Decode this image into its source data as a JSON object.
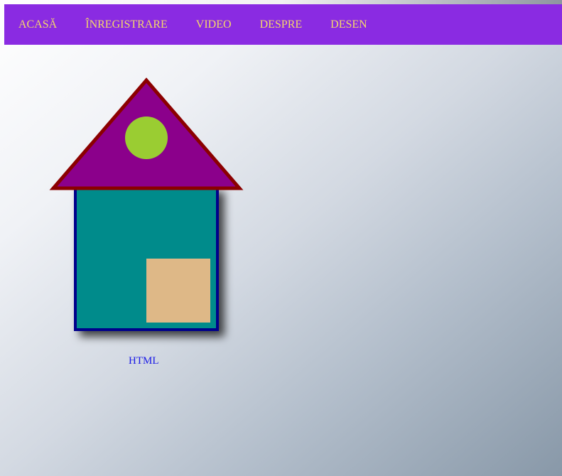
{
  "nav": {
    "items": [
      {
        "label": "ACASĂ"
      },
      {
        "label": "ÎNREGISTRARE"
      },
      {
        "label": "VIDEO"
      },
      {
        "label": "DESPRE"
      },
      {
        "label": "DESEN"
      }
    ]
  },
  "drawing": {
    "roof_fill": "#8b008b",
    "roof_stroke": "#8b0000",
    "sun_fill": "#9acd32",
    "wall_fill": "#008b8b",
    "wall_stroke": "#00008b",
    "window_fill": "#deb887",
    "caption": "HTML"
  },
  "theme": {
    "nav_background": "#8a2be2",
    "nav_text": "#f5d86a",
    "link_color": "#1a1ae6"
  }
}
